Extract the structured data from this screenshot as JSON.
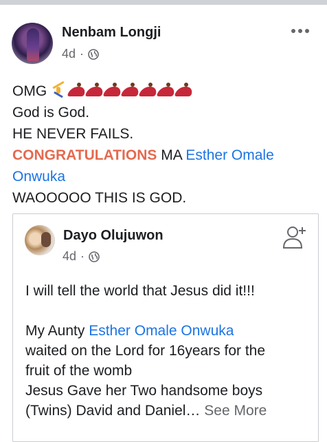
{
  "post": {
    "author": "Nenbam Longji",
    "time": "4d",
    "dot": "·",
    "lines": {
      "l1_prefix": "OMG",
      "l2": "God is God.",
      "l3": "HE NEVER FAILS.",
      "l4_congrats": "CONGRATULATIONS",
      "l4_ma": " MA ",
      "l4_mention": "Esther Omale",
      "l5_mention": "Onwuka",
      "l6": "WAOOOOO THIS IS GOD."
    },
    "emoji": [
      "person-cartwheeling",
      "woman-dancing",
      "woman-dancing",
      "woman-dancing",
      "woman-dancing",
      "woman-dancing",
      "woman-dancing",
      "woman-dancing"
    ]
  },
  "shared": {
    "author": "Dayo Olujuwon",
    "time": "4d",
    "dot": "·",
    "p1": "I will tell the world that Jesus did it!!!",
    "p2_prefix": "My Aunty ",
    "p2_mention": "Esther Omale Onwuka",
    "p3": "waited on the Lord for 16years for the",
    "p4": "fruit of the womb",
    "p5": "Jesus Gave her Two handsome boys",
    "p6": "(Twins) David and Daniel…",
    "see_more": "See More"
  },
  "colors": {
    "accent_link": "#1b74e4",
    "congrats": "#e46a4f",
    "meta_gray": "#65676b"
  }
}
